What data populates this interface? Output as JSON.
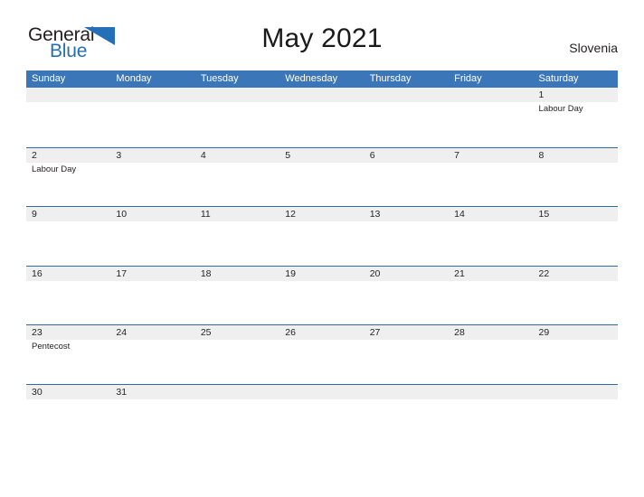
{
  "brand": {
    "name_part1": "General",
    "name_part2": "Blue",
    "logo_icon": "triangle-icon",
    "color_dark": "#231f20",
    "color_blue": "#2470b8"
  },
  "header": {
    "title": "May 2021",
    "region": "Slovenia"
  },
  "theme": {
    "header_blue": "#3a76b8",
    "rule_blue": "#2e6da4",
    "band_gray": "#efefef",
    "text": "#231f20"
  },
  "calendar": {
    "weekdays": [
      "Sunday",
      "Monday",
      "Tuesday",
      "Wednesday",
      "Thursday",
      "Friday",
      "Saturday"
    ],
    "weeks": [
      {
        "days": [
          {
            "date": "",
            "events": []
          },
          {
            "date": "",
            "events": []
          },
          {
            "date": "",
            "events": []
          },
          {
            "date": "",
            "events": []
          },
          {
            "date": "",
            "events": []
          },
          {
            "date": "",
            "events": []
          },
          {
            "date": "1",
            "events": [
              "Labour Day"
            ]
          }
        ]
      },
      {
        "days": [
          {
            "date": "2",
            "events": [
              "Labour Day"
            ]
          },
          {
            "date": "3",
            "events": []
          },
          {
            "date": "4",
            "events": []
          },
          {
            "date": "5",
            "events": []
          },
          {
            "date": "6",
            "events": []
          },
          {
            "date": "7",
            "events": []
          },
          {
            "date": "8",
            "events": []
          }
        ]
      },
      {
        "days": [
          {
            "date": "9",
            "events": []
          },
          {
            "date": "10",
            "events": []
          },
          {
            "date": "11",
            "events": []
          },
          {
            "date": "12",
            "events": []
          },
          {
            "date": "13",
            "events": []
          },
          {
            "date": "14",
            "events": []
          },
          {
            "date": "15",
            "events": []
          }
        ]
      },
      {
        "days": [
          {
            "date": "16",
            "events": []
          },
          {
            "date": "17",
            "events": []
          },
          {
            "date": "18",
            "events": []
          },
          {
            "date": "19",
            "events": []
          },
          {
            "date": "20",
            "events": []
          },
          {
            "date": "21",
            "events": []
          },
          {
            "date": "22",
            "events": []
          }
        ]
      },
      {
        "days": [
          {
            "date": "23",
            "events": [
              "Pentecost"
            ]
          },
          {
            "date": "24",
            "events": []
          },
          {
            "date": "25",
            "events": []
          },
          {
            "date": "26",
            "events": []
          },
          {
            "date": "27",
            "events": []
          },
          {
            "date": "28",
            "events": []
          },
          {
            "date": "29",
            "events": []
          }
        ]
      },
      {
        "days": [
          {
            "date": "30",
            "events": []
          },
          {
            "date": "31",
            "events": []
          },
          {
            "date": "",
            "events": []
          },
          {
            "date": "",
            "events": []
          },
          {
            "date": "",
            "events": []
          },
          {
            "date": "",
            "events": []
          },
          {
            "date": "",
            "events": []
          }
        ]
      }
    ]
  }
}
